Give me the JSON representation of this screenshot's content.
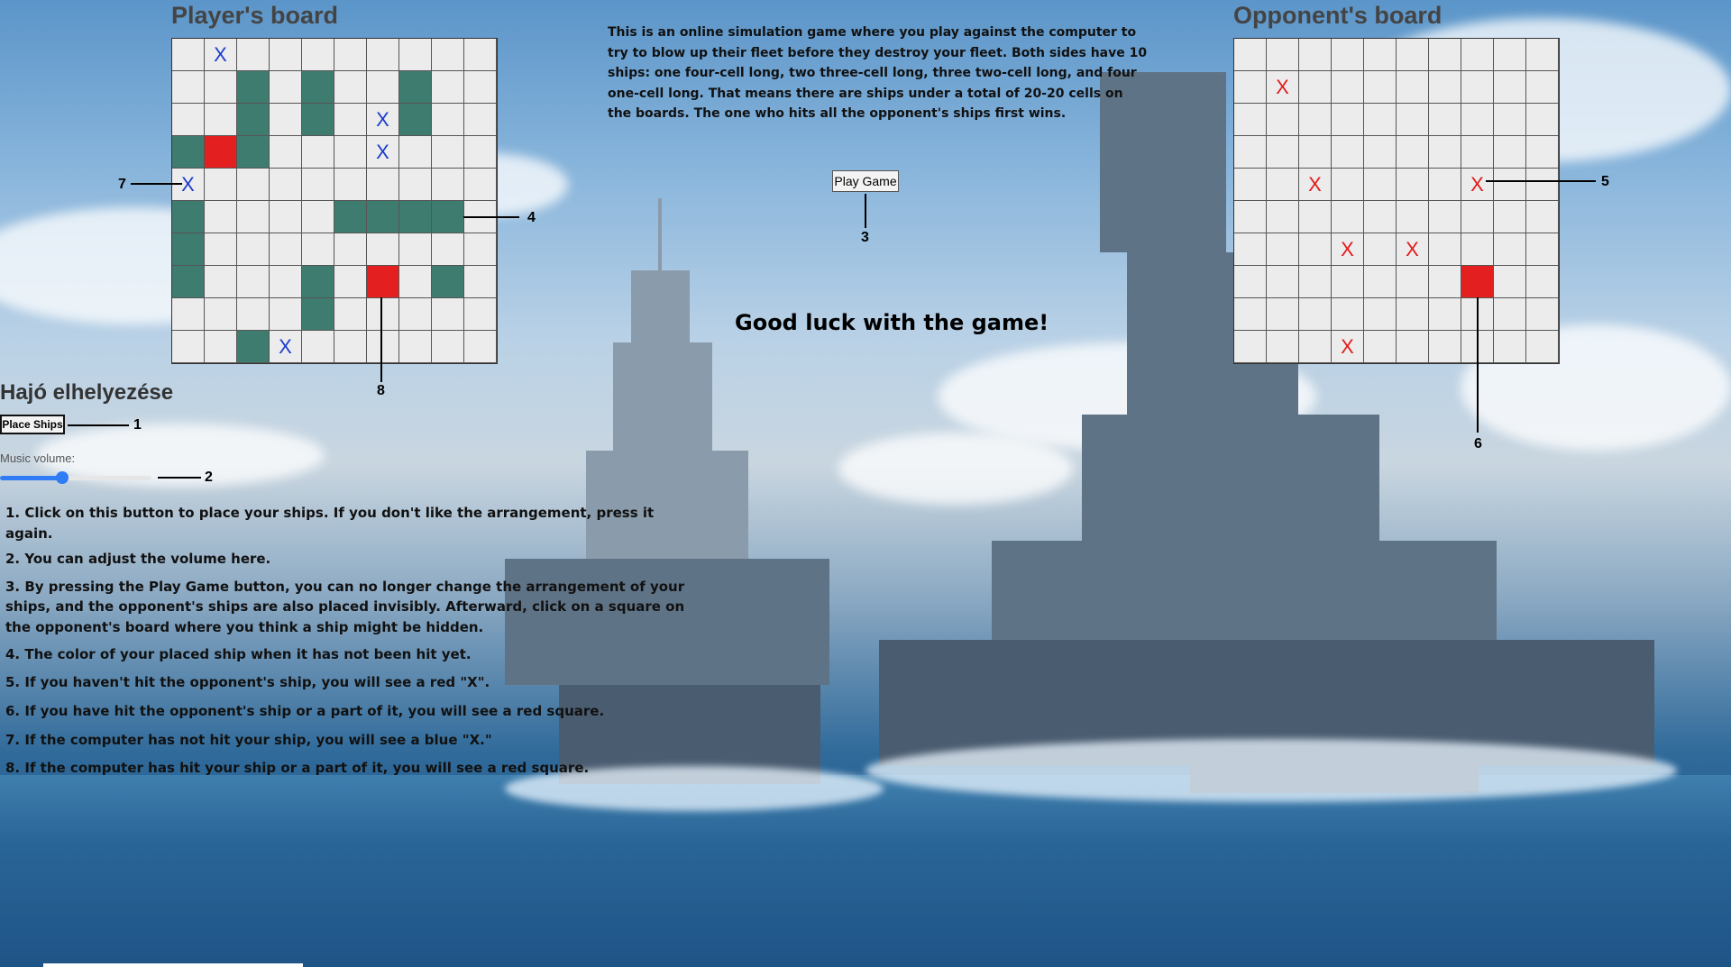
{
  "player_board": {
    "title": "Player's board",
    "ships": [
      [
        1,
        2
      ],
      [
        2,
        2
      ],
      [
        1,
        4
      ],
      [
        2,
        4
      ],
      [
        1,
        7
      ],
      [
        2,
        7
      ],
      [
        3,
        0
      ],
      [
        3,
        2
      ],
      [
        5,
        0
      ],
      [
        6,
        0
      ],
      [
        7,
        0
      ],
      [
        5,
        5
      ],
      [
        5,
        6
      ],
      [
        5,
        7
      ],
      [
        5,
        8
      ],
      [
        7,
        4
      ],
      [
        8,
        4
      ],
      [
        7,
        8
      ],
      [
        9,
        2
      ]
    ],
    "hits": [
      [
        3,
        1
      ],
      [
        7,
        6
      ]
    ],
    "misses": [
      [
        0,
        1
      ],
      [
        2,
        6
      ],
      [
        3,
        6
      ],
      [
        4,
        0
      ],
      [
        9,
        3
      ]
    ],
    "miss_mark": "X"
  },
  "opponent_board": {
    "title": "Opponent's board",
    "hits": [
      [
        7,
        7
      ]
    ],
    "misses": [
      [
        1,
        1
      ],
      [
        4,
        2
      ],
      [
        4,
        7
      ],
      [
        6,
        3
      ],
      [
        6,
        5
      ],
      [
        9,
        3
      ]
    ],
    "miss_mark": "X"
  },
  "intro_text": "This is an online simulation game where you play against the computer to try to blow up their fleet before they destroy your fleet. Both sides have 10 ships: one four-cell long, two three-cell long, three two-cell long, and four one-cell long. That means there are ships under a total of 20-20 cells on the boards. The one who hits all the opponent's ships first wins.",
  "play_button_label": "Play Game",
  "good_luck_text": "Good luck with the game!",
  "placement_title": "Hajó elhelyezése",
  "place_ships_label": "Place Ships",
  "music_volume_label": "Music volume:",
  "music_volume_value": 0.4,
  "callouts": [
    "1",
    "2",
    "3",
    "4",
    "5",
    "6",
    "7",
    "8"
  ],
  "instructions": [
    "1. Click on this button to place your ships. If you don't like the arrangement, press it again.",
    "2. You can adjust the volume here.",
    "3. By pressing the Play Game button, you can no longer change the arrangement of your ships, and the opponent's ships are also placed invisibly. Afterward, click on a square on the opponent's board where you think a ship might be hidden.",
    "4. The color of your placed ship when it has not been hit yet.",
    "5. If you haven't hit the opponent's ship, you will see a red \"X\".",
    "6. If you have hit the opponent's ship or a part of it, you will see a red square.",
    "7. If the computer has not hit your ship, you will see a blue \"X.\"",
    "8. If the computer has hit your ship or a part of it, you will see a red square."
  ],
  "colors": {
    "ship": "#3f7c70",
    "hit": "#e41f1f",
    "player_miss": "#1a3ccd",
    "opponent_miss": "#e21b1b",
    "empty_cell": "#ececec"
  }
}
